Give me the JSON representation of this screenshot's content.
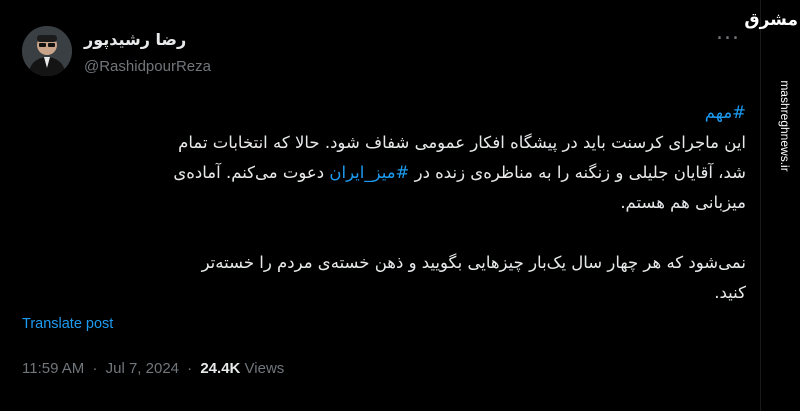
{
  "author": {
    "name": "رضا رشیدپور",
    "handle": "@RashidpourReza"
  },
  "more_label": "...",
  "tweet": {
    "hashtag_top": "#مهم",
    "line1": "این ماجرای کرسنت باید در پیشگاه افکار عمومی شفاف شود. حالا که انتخابات تمام",
    "line2_pre": "شد، آقایان جلیلی و زنگنه را به مناظره‌ی زنده در ",
    "line2_tag": "#میز_ایران",
    "line2_post": " دعوت می‌کنم. آماده‌ی",
    "line3": "میزبانی هم هستم.",
    "line4": "نمی‌شود که هر چهار سال یک‌بار چیزهایی بگویید و ذهن خسته‌ی مردم را خسته‌تر",
    "line5": "کنید."
  },
  "translate_label": "Translate post",
  "meta": {
    "time": "11:59 AM",
    "date": "Jul 7, 2024",
    "views_count": "24.4K",
    "views_label": "Views"
  },
  "watermark": {
    "logo": "مشرق",
    "url": "mashreghnews.ir"
  },
  "colors": {
    "background": "#000000",
    "text": "#e7e9ea",
    "muted": "#71767b",
    "link": "#1d9bf0"
  }
}
